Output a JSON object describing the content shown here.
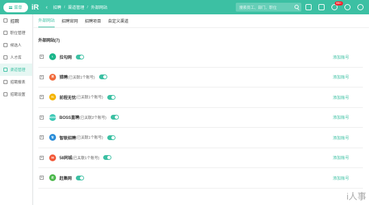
{
  "topbar": {
    "menu_label": "菜单",
    "logo_text": "iR",
    "back_icon": "arrow-left-icon",
    "breadcrumbs": [
      "招聘",
      "渠道管理",
      "外部网站"
    ],
    "search_placeholder": "搜索员工、部门、职位",
    "notification_count": "99+"
  },
  "sidebar": {
    "items": [
      {
        "label": "招聘",
        "icon": "doc-icon"
      },
      {
        "label": "职位管理",
        "icon": "briefcase-icon"
      },
      {
        "label": "候选人",
        "icon": "users-icon"
      },
      {
        "label": "人才库",
        "icon": "talent-icon"
      },
      {
        "label": "渠道管理",
        "icon": "channel-icon"
      },
      {
        "label": "招聘报表",
        "icon": "chart-icon"
      },
      {
        "label": "招聘设置",
        "icon": "settings-icon"
      }
    ]
  },
  "tabs": [
    "外部网站",
    "招聘官网",
    "招聘项目",
    "自定义渠道"
  ],
  "section_title": "外部网站(7)",
  "channels": [
    {
      "name": "拉勾网",
      "note": "",
      "color": "#1bb68b",
      "icon_text": "L"
    },
    {
      "name": "猎聘",
      "note": "(已关联1个账号)",
      "color": "#f06a3b",
      "icon_text": "猎"
    },
    {
      "name": "前程无忧",
      "note": "(已关联1个账号)",
      "color": "#f5b400",
      "icon_text": "51"
    },
    {
      "name": "BOSS直聘",
      "note": "(已关联2个账号)",
      "color": "#3cc9b6",
      "icon_text": "BOSS"
    },
    {
      "name": "智联招聘",
      "note": "(已关联1个账号)",
      "color": "#2a8dd8",
      "icon_text": "智"
    },
    {
      "name": "58同城",
      "note": "(已关联1个账号)",
      "color": "#f25a3a",
      "icon_text": "58"
    },
    {
      "name": "赶集网",
      "note": "",
      "color": "#4cb84c",
      "icon_text": "赶"
    }
  ],
  "add_account_label": "添加账号",
  "watermark": "i人事"
}
